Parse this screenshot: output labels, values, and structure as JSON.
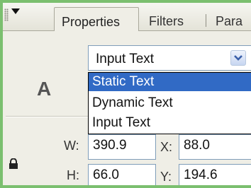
{
  "tabs": [
    {
      "label": "Properties",
      "active": true
    },
    {
      "label": "Filters",
      "active": false
    },
    {
      "label": "Para",
      "active": false
    }
  ],
  "text_type_icon": "A",
  "text_type_select": {
    "value": "Input Text",
    "options": [
      "Static Text",
      "Dynamic Text",
      "Input Text"
    ],
    "highlighted": "Static Text"
  },
  "dimensions": {
    "w_label": "W:",
    "w_value": "390.9",
    "x_label": "X:",
    "x_value": "88.0",
    "h_label": "H:",
    "h_value": "66.0",
    "y_label": "Y:",
    "y_value": "194.6"
  },
  "icons": [
    "grip-icon",
    "collapse-arrow-icon",
    "dropdown-arrow-icon",
    "lock-icon"
  ],
  "colors": {
    "selection": "#316ac5",
    "field_border": "#7f9db9",
    "frame_accent": "#7bbf6f"
  }
}
